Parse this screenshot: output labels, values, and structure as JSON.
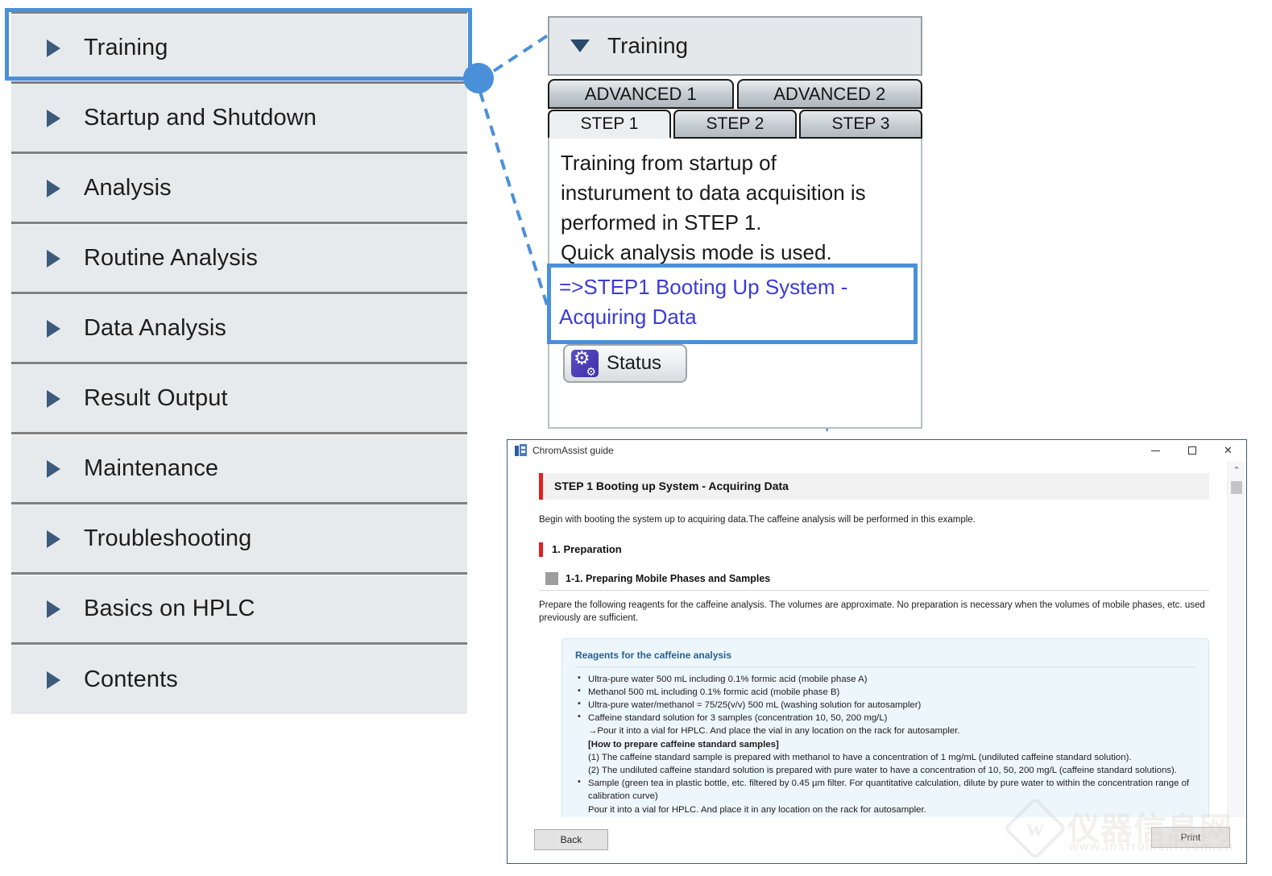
{
  "sidebar": {
    "items": [
      {
        "label": "Training",
        "selected": true,
        "icon": "triangle-right-icon"
      },
      {
        "label": "Startup and Shutdown",
        "selected": false,
        "icon": "triangle-right-icon"
      },
      {
        "label": "Analysis",
        "selected": false,
        "icon": "triangle-right-icon"
      },
      {
        "label": "Routine Analysis",
        "selected": false,
        "icon": "triangle-right-icon"
      },
      {
        "label": "Data Analysis",
        "selected": false,
        "icon": "triangle-right-icon"
      },
      {
        "label": "Result Output",
        "selected": false,
        "icon": "triangle-right-icon"
      },
      {
        "label": "Maintenance",
        "selected": false,
        "icon": "triangle-right-icon"
      },
      {
        "label": "Troubleshooting",
        "selected": false,
        "icon": "triangle-right-icon"
      },
      {
        "label": "Basics on HPLC",
        "selected": false,
        "icon": "triangle-right-icon"
      },
      {
        "label": "Contents",
        "selected": false,
        "icon": "triangle-right-icon"
      }
    ],
    "selection_ring_color": "#4a90d9"
  },
  "callout": {
    "dot_color": "#4a90d9",
    "line_color": "#4a90d9"
  },
  "mid_panel": {
    "header": {
      "label": "Training",
      "icon": "triangle-down-icon"
    },
    "advanced_tabs": [
      {
        "label": "ADVANCED 1",
        "active": false
      },
      {
        "label": "ADVANCED 2",
        "active": false
      }
    ],
    "step_tabs": [
      {
        "label": "STEP 1",
        "active": true
      },
      {
        "label": "STEP 2",
        "active": false
      },
      {
        "label": "STEP 3",
        "active": false
      }
    ],
    "body_lines": [
      "Training from startup of",
      "insturument to data acquisition is",
      "performed in STEP 1.",
      "Quick analysis mode is used."
    ],
    "link": {
      "text": "=>STEP1 Booting Up System - Acquiring Data",
      "color": "#3b3bd8",
      "highlight_color": "#4a90d9"
    },
    "status_button": {
      "label": "Status",
      "icon": "gears-icon"
    }
  },
  "window": {
    "title": "ChromAssist guide",
    "app_icon": "chromassist-app-icon",
    "controls": {
      "minimize": "–",
      "maximize": "☐",
      "close": "✕"
    },
    "heading": "STEP 1 Booting up System - Acquiring Data",
    "lead": "Begin with booting the system up to acquiring data.The caffeine analysis will be performed in this example.",
    "section_heading": "1. Preparation",
    "subsection_heading": "1-1. Preparing Mobile Phases and Samples",
    "paragraph": "Prepare the following reagents for the caffeine analysis. The volumes are approximate. No preparation is necessary when the volumes of mobile phases, etc. used previously are sufficient.",
    "reagent_box": {
      "title": "Reagents for the caffeine analysis",
      "accent_color": "#28628f",
      "background_color": "#edf6fb",
      "items": [
        {
          "text": "Ultra-pure water 500 mL including 0.1% formic acid (mobile phase A)",
          "subs": []
        },
        {
          "text": "Methanol 500 mL including 0.1% formic acid (mobile phase B)",
          "subs": []
        },
        {
          "text": "Ultra-pure water/methanol = 75/25(v/v) 500 mL (washing solution for autosampler)",
          "subs": []
        },
        {
          "text": "Caffeine standard solution for 3 samples (concentration 10, 50, 200 mg/L)",
          "subs": [
            {
              "text": "→Pour it into a vial for HPLC. And place the vial in any location on the rack for autosampler.",
              "bold": false
            },
            {
              "text": "[How to prepare caffeine standard samples]",
              "bold": true
            },
            {
              "text": "(1) The caffeine standard sample is prepared with methanol to have a concentration of 1 mg/mL (undiluted caffeine standard solution).",
              "bold": false
            },
            {
              "text": "(2) The undiluted caffeine standard solution is prepared with pure water to have a concentration of 10, 50, 200 mg/L (caffeine standard solutions).",
              "bold": false
            }
          ]
        },
        {
          "text": "Sample (green tea in plastic bottle, etc. filtered by 0.45 µm filter. For quantitative calculation, dilute by pure water to within the concentration range of calibration curve)",
          "subs": [
            {
              "text": "Pour it into a vial for HPLC. And place it in any location on the rack for autosampler.",
              "bold": false
            }
          ]
        }
      ]
    },
    "back_button": "Back",
    "print_button": "Print",
    "scrollbar": {
      "up_arrow": "⌃",
      "down_arrow": "⌄"
    }
  },
  "watermark": {
    "mark": "仪器信息网",
    "url": "www.instrument.com.cn",
    "logo_letter": "w"
  }
}
